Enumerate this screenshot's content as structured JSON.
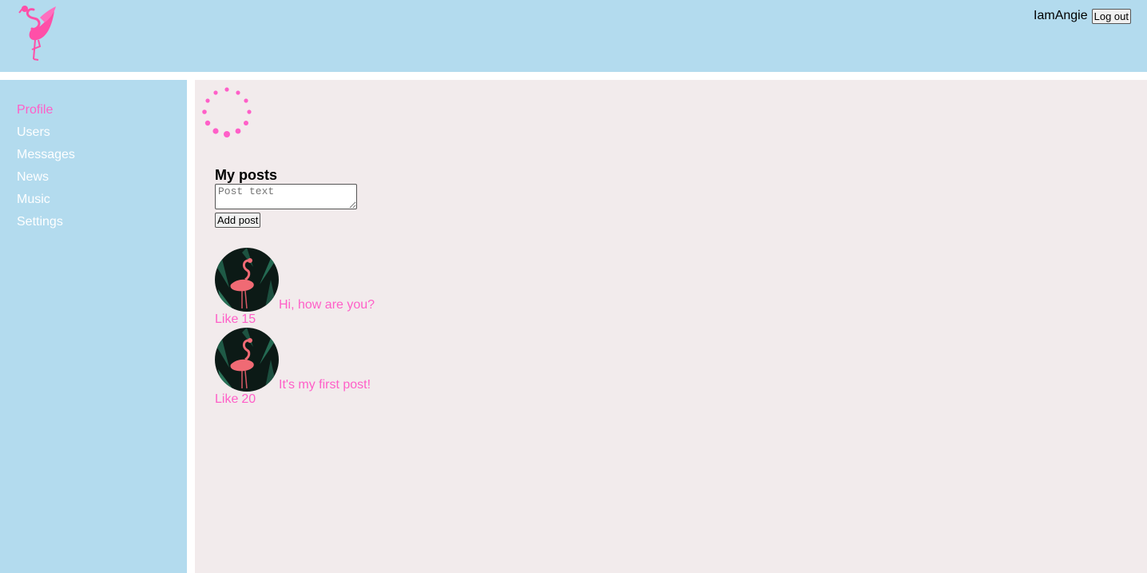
{
  "header": {
    "logo_icon": "flamingo-logo-icon",
    "username": "IamAngie",
    "logout_label": "Log out"
  },
  "sidebar": {
    "items": [
      {
        "label": "Profile",
        "active": true
      },
      {
        "label": "Users",
        "active": false
      },
      {
        "label": "Messages",
        "active": false
      },
      {
        "label": "News",
        "active": false
      },
      {
        "label": "Music",
        "active": false
      },
      {
        "label": "Settings",
        "active": false
      }
    ]
  },
  "main": {
    "loader_icon": "loading-spinner-icon",
    "posts_title": "My posts",
    "post_input": {
      "placeholder": "Post text",
      "value": ""
    },
    "add_post_label": "Add post",
    "posts": [
      {
        "avatar_icon": "flamingo-avatar-icon",
        "text": "Hi, how are you?",
        "like_label": "Like",
        "likes": "15"
      },
      {
        "avatar_icon": "flamingo-avatar-icon",
        "text": "It's my first post!",
        "like_label": "Like",
        "likes": "20"
      }
    ]
  },
  "colors": {
    "header_bg": "#b3dbee",
    "sidebar_bg": "#b3dbee",
    "content_bg": "#f2ebec",
    "accent": "#ff5fc8",
    "nav_text": "#ffffff"
  }
}
